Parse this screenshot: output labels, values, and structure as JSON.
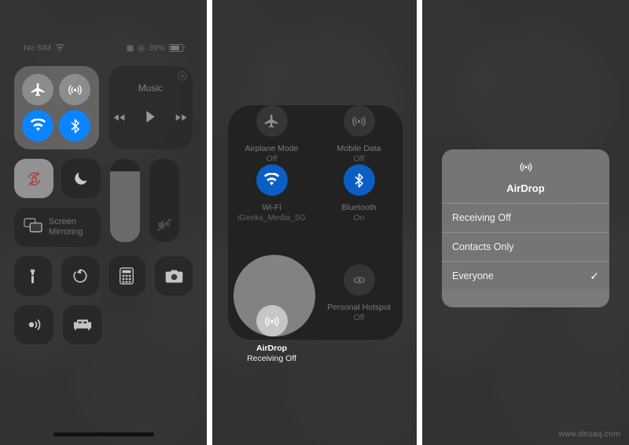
{
  "meta": {
    "watermark": "www.deuaq.com",
    "accent_blue": "#0a84ff",
    "deep_blue": "#0b5fc4",
    "background": "#3d3d3d"
  },
  "panel1": {
    "statusbar": {
      "carrier": "No SIM",
      "battery_percent": "39%"
    },
    "connectivity": {
      "airplane_mode": {
        "label": "Airplane Mode",
        "state": "off"
      },
      "mobile_data": {
        "label": "Mobile Data",
        "state": "off"
      },
      "wifi": {
        "label": "Wi-Fi",
        "state": "on"
      },
      "bluetooth": {
        "label": "Bluetooth",
        "state": "on"
      }
    },
    "music": {
      "title": "Music"
    },
    "rotation_lock": {
      "label": "Rotation Lock",
      "state": "on"
    },
    "do_not_disturb": {
      "label": "Do Not Disturb",
      "state": "off"
    },
    "brightness": {
      "label": "Brightness",
      "value": 85
    },
    "volume": {
      "label": "Volume",
      "value": 0,
      "muted": true
    },
    "screen_mirroring": {
      "label": "Screen Mirroring"
    },
    "tiles": [
      {
        "name": "flashlight",
        "label": "Flashlight"
      },
      {
        "name": "timer",
        "label": "Timer"
      },
      {
        "name": "calculator",
        "label": "Calculator"
      },
      {
        "name": "camera",
        "label": "Camera"
      },
      {
        "name": "nfc-tag-reader",
        "label": "NFC Tag Reader"
      },
      {
        "name": "sleep-mode",
        "label": "Sleep"
      }
    ]
  },
  "panel2": {
    "expanded_connectivity": [
      {
        "name": "airplane-mode",
        "label": "Airplane Mode",
        "status": "Off",
        "state": "off",
        "highlight": false
      },
      {
        "name": "mobile-data",
        "label": "Mobile Data",
        "status": "Off",
        "state": "off",
        "highlight": false
      },
      {
        "name": "wifi",
        "label": "Wi-Fi",
        "status": "iGeeks_Media_5G",
        "state": "on",
        "highlight": false
      },
      {
        "name": "bluetooth",
        "label": "Bluetooth",
        "status": "On",
        "state": "on",
        "highlight": false
      },
      {
        "name": "airdrop",
        "label": "AirDrop",
        "status": "Receiving Off",
        "state": "off",
        "highlight": true
      },
      {
        "name": "personal-hotspot",
        "label": "Personal Hotspot",
        "status": "Off",
        "state": "off",
        "highlight": false
      }
    ]
  },
  "panel3": {
    "airdrop_dialog": {
      "title": "AirDrop",
      "options": [
        {
          "label": "Receiving Off",
          "selected": false
        },
        {
          "label": "Contacts Only",
          "selected": false
        },
        {
          "label": "Everyone",
          "selected": true
        }
      ],
      "check_glyph": "✓"
    }
  }
}
